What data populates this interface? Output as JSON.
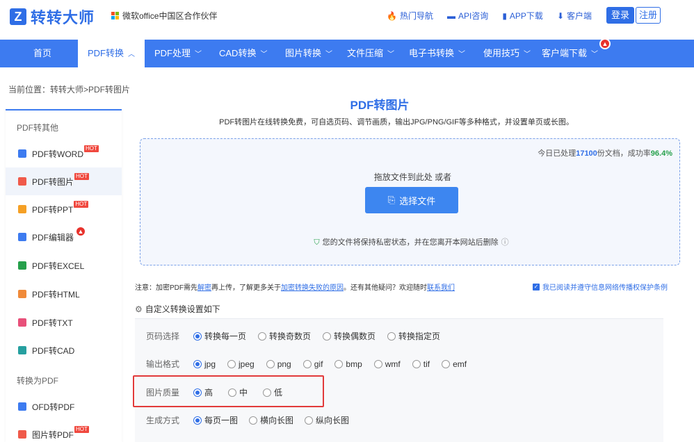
{
  "header": {
    "logo_mark": "Z",
    "logo_text": "转转大师",
    "partner": "微软office中国区合作伙伴",
    "links": [
      {
        "icon": "fire-icon",
        "label": "热门导航"
      },
      {
        "icon": "chat-icon",
        "label": "API咨询"
      },
      {
        "icon": "phone-icon",
        "label": "APP下载"
      },
      {
        "icon": "download-icon",
        "label": "客户端"
      }
    ],
    "login": "登录",
    "register": "注册"
  },
  "nav": {
    "items": [
      {
        "label": "首页"
      },
      {
        "label": "PDF转换"
      },
      {
        "label": "PDF处理"
      },
      {
        "label": "CAD转换"
      },
      {
        "label": "图片转换"
      },
      {
        "label": "文件压缩"
      },
      {
        "label": "电子书转换"
      },
      {
        "label": "使用技巧"
      },
      {
        "label": "客户端下载"
      }
    ]
  },
  "breadcrumb": "当前位置：转转大师>PDF转图片",
  "sidebar": {
    "group1": "PDF转其他",
    "group2": "转换为PDF",
    "hot_label": "HOT",
    "items": [
      {
        "label": "PDF转WORD",
        "color": "#3d7bf0"
      },
      {
        "label": "PDF转图片",
        "color": "#f05a4a"
      },
      {
        "label": "PDF转PPT",
        "color": "#f5a025"
      },
      {
        "label": "PDF编辑器",
        "color": "#3d7bf0"
      },
      {
        "label": "PDF转EXCEL",
        "color": "#26a04b"
      },
      {
        "label": "PDF转HTML",
        "color": "#f08a3a"
      },
      {
        "label": "PDF转TXT",
        "color": "#e8507a"
      },
      {
        "label": "PDF转CAD",
        "color": "#26a0a0"
      },
      {
        "label": "OFD转PDF",
        "color": "#3d7bf0"
      },
      {
        "label": "图片转PDF",
        "color": "#f05a4a"
      }
    ]
  },
  "main": {
    "title": "PDF转图片",
    "subtitle": "PDF转图片在线转换免费，可自选页码、调节画质，输出JPG/PNG/GIF等多种格式，并设置单页或长图。",
    "stats_prefix": "今日已处理",
    "stats_count": "17100",
    "stats_mid": "份文档，成功率",
    "stats_rate": "96.4%",
    "drop_hint": "拖放文件到此处 或者",
    "choose_btn": "选择文件",
    "privacy": "您的文件将保持私密状态，并在您离开本网站后删除",
    "notice_1": "注意：加密PDF需先",
    "notice_link1": "解密",
    "notice_2": "再上传，了解更多关于",
    "notice_link2": "加密转换失败的原因",
    "notice_3": "。还有其他疑问？欢迎随时",
    "notice_link3": "联系我们",
    "agree": "我已阅读并遵守信息网络传播权保护条例",
    "custom_title": "自定义转换设置如下"
  },
  "settings": {
    "page": {
      "label": "页码选择",
      "options": [
        "转换每一页",
        "转换奇数页",
        "转换偶数页",
        "转换指定页"
      ],
      "selected": 0
    },
    "format": {
      "label": "输出格式",
      "options": [
        "jpg",
        "jpeg",
        "png",
        "gif",
        "bmp",
        "wmf",
        "tif",
        "emf"
      ],
      "selected": 0
    },
    "quality": {
      "label": "图片质量",
      "options": [
        "高",
        "中",
        "低"
      ],
      "selected": 0
    },
    "mode": {
      "label": "生成方式",
      "options": [
        "每页一图",
        "横向长图",
        "纵向长图"
      ],
      "selected": 0
    }
  }
}
